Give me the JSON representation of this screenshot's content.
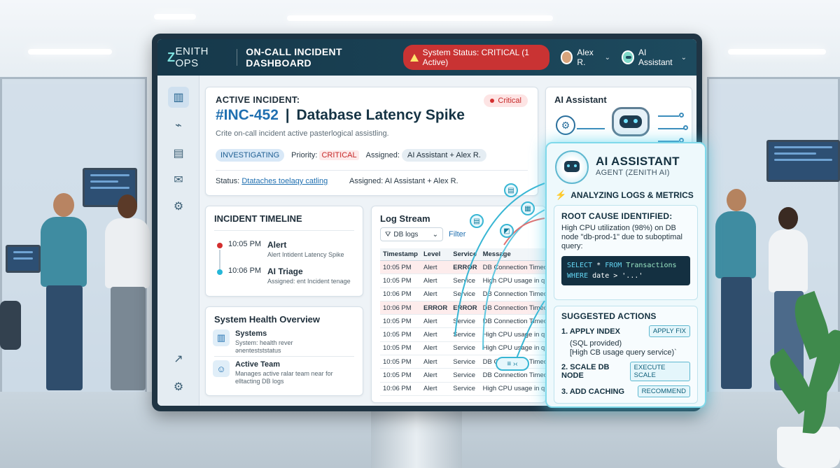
{
  "app": {
    "logo_mark": "Z",
    "logo_text": "ENITH OPS",
    "title": "ON-CALL INCIDENT DASHBOARD",
    "status_text": "System Status: CRITICAL (1 Active)",
    "user_name": "Alex R.",
    "ai_label": "AI Assistant"
  },
  "sidebar": {
    "items": [
      {
        "icon": "bar-chart-icon",
        "glyph": "▥"
      },
      {
        "icon": "pulse-monitor-icon",
        "glyph": "⌁"
      },
      {
        "icon": "analytics-icon",
        "glyph": "▤"
      },
      {
        "icon": "chat-icon",
        "glyph": "✉"
      },
      {
        "icon": "settings-icon",
        "glyph": "⚙"
      },
      {
        "icon": "trend-icon",
        "glyph": "↗"
      },
      {
        "icon": "settings-bottom-icon",
        "glyph": "⚙"
      }
    ]
  },
  "incident": {
    "label": "ACTIVE INCIDENT:",
    "id": "#INC-452",
    "separator": "|",
    "name": "Database Latency Spike",
    "severity": "Critical",
    "description": "Crite on-call incident active pasterlogical assistling.",
    "status_tag": "INVESTIGATING",
    "priority_label": "Priority:",
    "priority_value": "CRITICAL",
    "assigned_label": "Assigned:",
    "assigned_value": "AI Assistant + Alex R.",
    "status_label": "Status:",
    "status_link": "Dtataches toelaqy catling",
    "assigned_line": "Assigned: AI Assistant + Alex R."
  },
  "timeline": {
    "title": "INCIDENT TIMELINE",
    "items": [
      {
        "time": "10:05 PM",
        "title": "Alert",
        "sub": "Alert Intident Latency Spike",
        "color": "#d32f2f"
      },
      {
        "time": "10:06 PM",
        "title": "AI Triage",
        "sub": "Assigned: ent Incident tenage",
        "color": "#26b7d8"
      }
    ]
  },
  "health": {
    "title": "System Health Overview",
    "items": [
      {
        "title": "Systems",
        "sub": "System: health rever ǝnentestststatus"
      },
      {
        "title": "Active Team",
        "sub": "Manages active ralar team near for elltacting DB logs"
      }
    ]
  },
  "logs": {
    "title": "Log Stream",
    "filter_value": "DB logs",
    "filter_link": "Filter",
    "columns": [
      "Timestamp",
      "Level",
      "Service",
      "Message"
    ],
    "rows": [
      {
        "ts": "10:05 PM",
        "level": "Alert",
        "service": "ERROR",
        "msg": "DB Connection Timeout",
        "err": true
      },
      {
        "ts": "10:05 PM",
        "level": "Alert",
        "service": "Service",
        "msg": "High CPU usage in query"
      },
      {
        "ts": "10:06 PM",
        "level": "Alert",
        "service": "Service",
        "msg": "DB Connection Timeout"
      },
      {
        "ts": "10:06 PM",
        "level": "ERROR",
        "service": "ERROR",
        "msg": "DB Connection Timeout",
        "err": true
      },
      {
        "ts": "10:05 PM",
        "level": "Alert",
        "service": "Service",
        "msg": "DB Connection Timeout"
      },
      {
        "ts": "10:05 PM",
        "level": "Alert",
        "service": "Service",
        "msg": "High CPU usage in query"
      },
      {
        "ts": "10:05 PM",
        "level": "Alert",
        "service": "Service",
        "msg": "High CPU usage in query"
      },
      {
        "ts": "10:05 PM",
        "level": "Alert",
        "service": "Service",
        "msg": "DB Connection Timeout"
      },
      {
        "ts": "10:05 PM",
        "level": "Alert",
        "service": "Service",
        "msg": "DB Connection Timeout"
      },
      {
        "ts": "10:06 PM",
        "level": "Alert",
        "service": "Service",
        "msg": "High CPU usage in query"
      }
    ]
  },
  "ai_card": {
    "title": "AI Assistant"
  },
  "ai_panel": {
    "title": "AI ASSISTANT",
    "subtitle": "AGENT (ZENITH AI)",
    "analyzing": "ANALYZING LOGS & METRICS",
    "root_title": "ROOT CAUSE IDENTIFIED:",
    "root_text": "High CPU utilization (98%) on DB node \"db-prod-1\" due to suboptimal query:",
    "code_kw1": "SELECT",
    "code_star": " * ",
    "code_kw2": "FROM",
    "code_table": " Transactions",
    "code_kw3": "WHERE",
    "code_cond": " date > '...'",
    "actions_title": "SUGGESTED ACTIONS",
    "actions": [
      {
        "label": "1. APPLY INDEX",
        "button": "APPLY FIX",
        "note": "(SQL provided)\n[High CB usage query service)`"
      },
      {
        "label": "2. SCALE DB NODE",
        "button": "EXECUTE SCALE"
      },
      {
        "label": "3. ADD CACHING",
        "button": "RECOMMEND"
      }
    ]
  },
  "colors": {
    "accent": "#1f6fb0",
    "critical": "#c62828",
    "ai_glow": "#7fd9ea",
    "topbar": "#16384a"
  }
}
